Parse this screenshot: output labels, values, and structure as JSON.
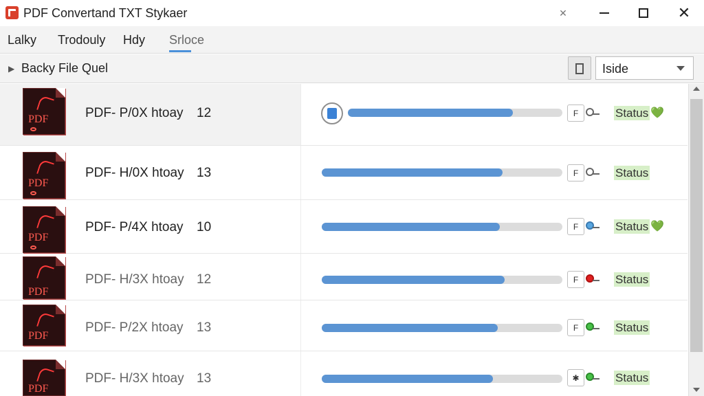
{
  "window": {
    "title": "PDF Convertand TXT Stykaer",
    "app_icon": "pdf-app-icon",
    "close_glyph": "✕",
    "close_small_glyph": "✕"
  },
  "menu": {
    "items": [
      "Lalky",
      "Trodouly",
      "Hdy",
      "Srloce"
    ],
    "active_index": 3,
    "accent_color": "#4a90d9"
  },
  "toolbar": {
    "arrow_glyph": "▶",
    "label": "Backy File Quel",
    "view_icon": "bookmark-icon",
    "select_value": "Iside"
  },
  "rows": [
    {
      "name": "PDF- P/0X  htoay",
      "count": "12",
      "progress": 0.77,
      "f_label": "F",
      "pin": "gray",
      "status": "Status",
      "heart": true,
      "selected": true,
      "faded": false,
      "circle": true
    },
    {
      "name": "PDF- H/0X  htoay",
      "count": "13",
      "progress": 0.75,
      "f_label": "F",
      "pin": "gray",
      "status": "Status",
      "heart": false,
      "selected": false,
      "faded": false,
      "circle": false
    },
    {
      "name": "PDF- P/4X  htoay",
      "count": "10",
      "progress": 0.74,
      "f_label": "F",
      "pin": "blue",
      "status": "Status",
      "heart": true,
      "selected": false,
      "faded": false,
      "circle": false
    },
    {
      "name": "PDF- H/3X  htoay",
      "count": "12",
      "progress": 0.76,
      "f_label": "F",
      "pin": "red",
      "status": "Status",
      "heart": false,
      "selected": false,
      "faded": true,
      "circle": false
    },
    {
      "name": "PDF- P/2X  htoay",
      "count": "13",
      "progress": 0.73,
      "f_label": "F",
      "pin": "green",
      "status": "Status",
      "heart": false,
      "selected": false,
      "faded": true,
      "circle": false
    },
    {
      "name": "PDF- H/3X  htoay",
      "count": "13",
      "progress": 0.71,
      "f_label": "✱",
      "pin": "green",
      "status": "Status",
      "heart": false,
      "selected": false,
      "faded": true,
      "circle": false
    }
  ],
  "pdf_icon_label": "PDF",
  "heart_glyph": "💚",
  "colors": {
    "progress_fill": "#5b94d3",
    "progress_track": "#dcdcdc",
    "status_bg": "#d7efc8",
    "pdf_icon_red": "#ff5a50"
  }
}
